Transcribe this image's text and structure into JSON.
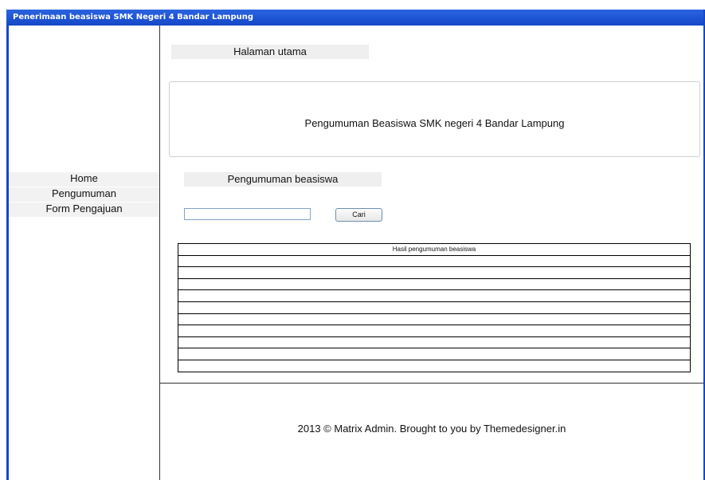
{
  "window": {
    "title": "Penerimaan beasiswa SMK Negeri 4 Bandar Lampung"
  },
  "sidebar": {
    "items": [
      {
        "label": "Home"
      },
      {
        "label": "Pengumuman"
      },
      {
        "label": "Form Pengajuan"
      }
    ]
  },
  "main": {
    "page_tab": "Halaman utama",
    "announcement": "Pengumuman Beasiswa SMK negeri 4 Bandar Lampung",
    "section_tab": "Pengumuman beasiswa",
    "search": {
      "value": "",
      "placeholder": "",
      "button_label": "Cari"
    },
    "table": {
      "header": "Hasil pengumuman beasiswa",
      "rows": [
        "",
        "",
        "",
        "",
        "",
        "",
        "",
        "",
        "",
        ""
      ]
    }
  },
  "footer": {
    "text": "2013 © Matrix Admin. Brought to you by Themedesigner.in"
  },
  "colors": {
    "titlebar": "#1448c8",
    "tab_background": "#efefef",
    "menu_background": "#f2f2f2"
  }
}
